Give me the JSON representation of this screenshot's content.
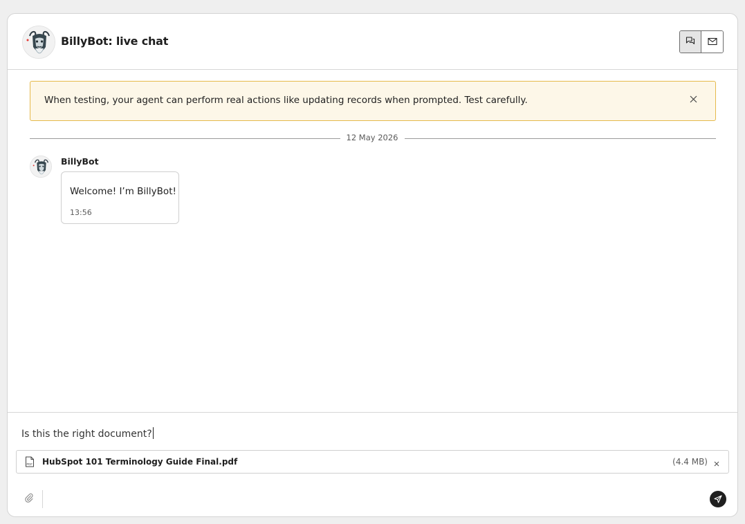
{
  "header": {
    "title": "BillyBot: live chat",
    "avatar_icon": "goat-avatar-icon",
    "view_toggles": [
      {
        "name": "chat-view",
        "icon": "chat-bubbles-icon",
        "active": true
      },
      {
        "name": "email-view",
        "icon": "envelope-icon",
        "active": false
      }
    ]
  },
  "banner": {
    "text": "When testing, your agent can perform real actions like updating records when prompted. Test carefully.",
    "close_icon": "close-icon",
    "bg_color": "#fdf7e8",
    "border_color": "#e5b94a"
  },
  "conversation": {
    "date": "12 May 2026",
    "messages": [
      {
        "sender": "BillyBot",
        "text": "Welcome! I’m BillyBot!",
        "time": "13:56"
      }
    ]
  },
  "composer": {
    "input_value": "Is this the right document?",
    "attachment": {
      "file_name": "HubSpot 101 Terminology Guide Final.pdf",
      "file_size": "(4.4 MB)",
      "file_icon": "pdf-file-icon",
      "remove_icon": "close-icon"
    },
    "attach_icon": "paperclip-icon",
    "send_icon": "send-icon"
  }
}
